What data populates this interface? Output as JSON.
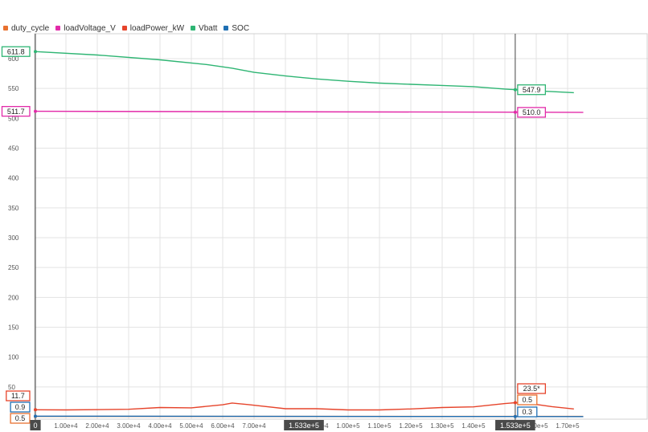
{
  "chart_data": {
    "type": "line",
    "xlim": [
      0,
      175000
    ],
    "ylim": [
      0,
      640
    ],
    "grid": true,
    "legend_position": "top-left",
    "x_ticks": [
      "0",
      "1.00e+4",
      "2.00e+4",
      "3.00e+4",
      "4.00e+4",
      "5.00e+4",
      "6.00e+4",
      "7.00e+4",
      "9.00e+4",
      "1.00e+5",
      "1.10e+5",
      "1.20e+5",
      "1.30e+5",
      "1.40e+5",
      "1.60e+5",
      "1.70e+5"
    ],
    "x_tick_values": [
      0,
      10000,
      20000,
      30000,
      40000,
      50000,
      60000,
      70000,
      90000,
      100000,
      110000,
      120000,
      130000,
      140000,
      160000,
      170000
    ],
    "y_ticks": [
      "50",
      "100",
      "150",
      "200",
      "250",
      "300",
      "350",
      "400",
      "450",
      "500",
      "550",
      "600"
    ],
    "y_tick_values": [
      50,
      100,
      150,
      200,
      250,
      300,
      350,
      400,
      450,
      500,
      550,
      600
    ],
    "cursor": {
      "x": 153300,
      "label": "1.533e+5"
    },
    "series": [
      {
        "name": "duty_cycle",
        "color": "#e8712f",
        "x": [
          0,
          175000
        ],
        "y": [
          0.5,
          0.5
        ],
        "start_label": "0.5",
        "cursor_label": "0.5"
      },
      {
        "name": "loadVoltage_V",
        "color": "#e22ba9",
        "x": [
          0,
          175000
        ],
        "y": [
          511.7,
          510.0
        ],
        "start_label": "511.7",
        "cursor_label": "510.0"
      },
      {
        "name": "loadPower_kW",
        "color": "#e6442b",
        "x": [
          0,
          10000,
          30000,
          40000,
          50000,
          60000,
          63000,
          68000,
          80000,
          90000,
          100000,
          110000,
          120000,
          130000,
          140000,
          150000,
          153300,
          158000,
          165000,
          172000
        ],
        "y": [
          11.7,
          11.5,
          12.5,
          15.5,
          15.0,
          20.0,
          23.0,
          20.5,
          13.5,
          13.5,
          11.5,
          11.5,
          13.0,
          15.5,
          16.5,
          22.0,
          23.5,
          22.0,
          17.0,
          13.0
        ],
        "start_label": "11.7",
        "cursor_label": "23.5*"
      },
      {
        "name": "Vbatt",
        "color": "#2eb573",
        "x": [
          0,
          20000,
          40000,
          55000,
          63000,
          70000,
          80000,
          90000,
          100000,
          110000,
          120000,
          130000,
          140000,
          150000,
          153300,
          160000,
          172000
        ],
        "y": [
          611.8,
          606.0,
          598.0,
          590.0,
          584.0,
          577.0,
          571.0,
          566.0,
          562.0,
          559.0,
          557.0,
          555.0,
          553.0,
          549.0,
          547.9,
          546.0,
          543.0
        ],
        "start_label": "611.8",
        "cursor_label": "547.9"
      },
      {
        "name": "SOC",
        "color": "#1f6fb3",
        "x": [
          0,
          175000
        ],
        "y": [
          0.9,
          0.3
        ],
        "start_label": "0.9",
        "cursor_label": "0.3"
      }
    ]
  }
}
